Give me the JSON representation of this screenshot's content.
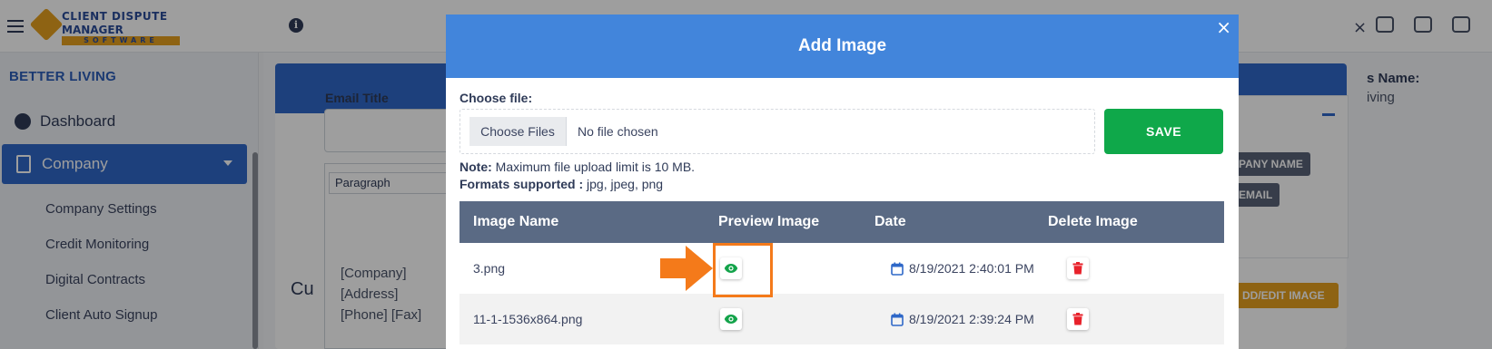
{
  "app": {
    "logo_line1": "CLIENT DISPUTE",
    "logo_line2": "MANAGER",
    "logo_line3": "SOFTWARE",
    "info_icon": "i"
  },
  "sidebar": {
    "title": "BETTER LIVING",
    "items": [
      {
        "label": "Dashboard",
        "icon": "pie-chart-icon"
      },
      {
        "label": "Company",
        "icon": "building-icon"
      }
    ],
    "sub_items": [
      {
        "label": "Company Settings"
      },
      {
        "label": "Credit Monitoring"
      },
      {
        "label": "Digital Contracts"
      },
      {
        "label": "Client Auto Signup"
      }
    ]
  },
  "background": {
    "email_title_label": "Email Title",
    "paragraph_select": "Paragraph",
    "editor_lines": [
      "[Company]",
      "[Address]",
      "[Phone] [Fax]"
    ],
    "section_heading_partial": "Cu",
    "name_label_partial": "s Name:",
    "name_value_partial": "iving",
    "company_name_btn": "PANY NAME",
    "email_btn": "EMAIL",
    "add_edit_image_btn": "DD/EDIT IMAGE"
  },
  "modal": {
    "title": "Add Image",
    "close": "×",
    "choose_file_label": "Choose file:",
    "choose_files_button": "Choose Files",
    "file_status": "No file chosen",
    "save_button": "SAVE",
    "note_label": "Note:",
    "note_text": " Maximum file upload limit is 10 MB.",
    "formats_label": "Formats supported :",
    "formats_text": " jpg, jpeg, png",
    "table": {
      "headers": [
        "Image Name",
        "Preview Image",
        "Date",
        "Delete Image"
      ],
      "rows": [
        {
          "name": "3.png",
          "date": "8/19/2021 2:40:01 PM"
        },
        {
          "name": "11-1-1536x864.png",
          "date": "8/19/2021 2:39:24 PM"
        }
      ]
    }
  },
  "colors": {
    "modal_header": "#4285db",
    "save_green": "#0fa84a",
    "table_header": "#5a6a84",
    "highlight_orange": "#f47a1a",
    "delete_red": "#e8222b",
    "preview_green": "#13a34a"
  }
}
